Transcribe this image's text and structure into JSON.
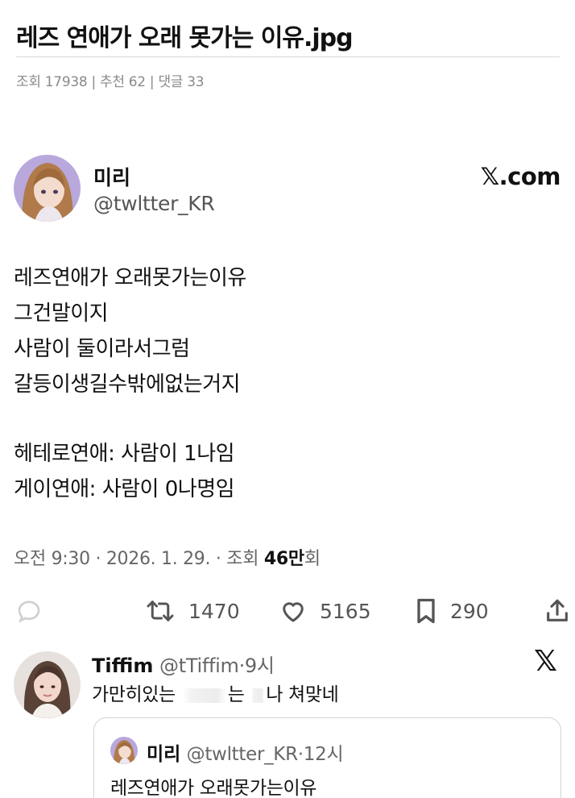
{
  "post": {
    "title": "레즈 연애가 오래 못가는 이유.jpg",
    "meta": "조회 17938 | 추천 62 | 댓글 33"
  },
  "tweet": {
    "author_name": "미리",
    "author_handle": "@twltter_KR",
    "brand": "𝕏.com",
    "lines": [
      "레즈연애가 오래못가는이유",
      "그건말이지",
      "사람이 둘이라서그럼",
      "갈등이생길수밖에없는거지",
      "",
      "헤테로연애: 사람이 1나임",
      "게이연애: 사람이 0나명임"
    ],
    "timestamp": "오전 9:30 · 2026. 1. 29. · 조회 ",
    "views": "46만",
    "views_suffix": "회",
    "stats": {
      "retweets": "1470",
      "likes": "5165",
      "bookmarks": "290"
    }
  },
  "reply": {
    "name": "Tiffim",
    "handle": "@tTiffim",
    "time": "9시",
    "text_start": "가만히있는 ",
    "text_mid": "는 ",
    "text_end": "나 쳐맞네",
    "logo": "𝕏"
  },
  "quote": {
    "name": "미리",
    "handle": "@twltter_KR",
    "time": "12시",
    "text": "레즈연애가 오래못가는이유"
  },
  "colors": {
    "text": "#111111",
    "muted": "#666666",
    "meta": "#8a8a8a",
    "border": "#d4d4d4"
  },
  "icons": [
    "reply-icon",
    "retweet-icon",
    "heart-icon",
    "bookmark-icon",
    "share-icon",
    "x-logo-icon"
  ]
}
